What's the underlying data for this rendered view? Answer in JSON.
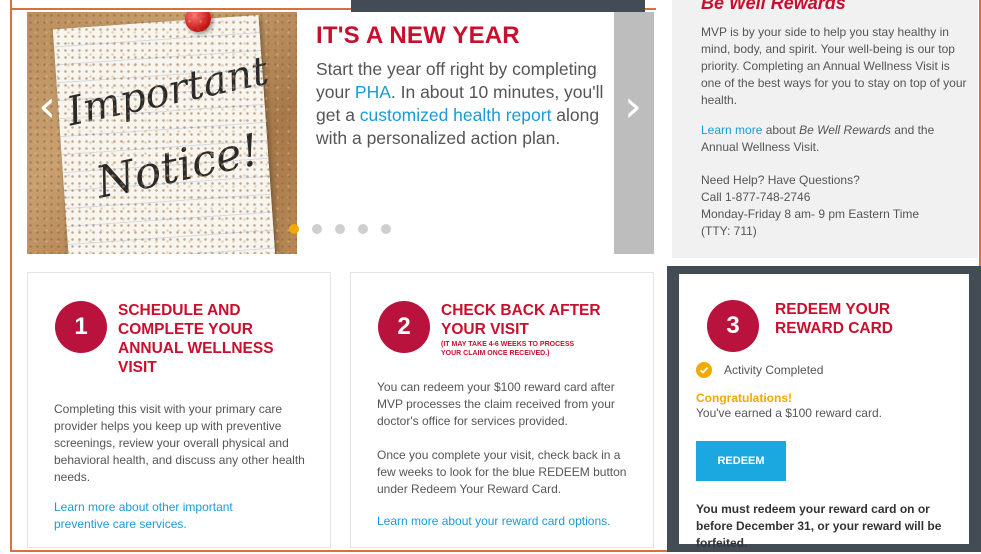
{
  "carousel": {
    "note_line1": "Important",
    "note_line2": "Notice!",
    "title": "IT'S A NEW YEAR",
    "body_pre": "Start the year off right by completing your ",
    "body_link1": "PHA",
    "body_mid": ". In about 10 minutes, you'll get a ",
    "body_link2": "customized health report",
    "body_post": " along with a personalized action plan.",
    "prev_arrow": "‹",
    "next_arrow": "›",
    "dot_count": 5,
    "active_dot": 0
  },
  "info": {
    "heading": "Be Well Rewards",
    "paragraph1": "MVP is by your side to help you stay healthy in mind, body, and spirit. Your well-being is our top priority. Completing an Annual Wellness Visit is one of the best ways for you to stay on top of your health.",
    "learn_more_link": "Learn more",
    "learn_more_mid": " about ",
    "learn_more_em": "Be Well Rewards",
    "learn_more_post": " and the Annual Wellness Visit.",
    "help_line1": "Need Help? Have Questions?",
    "help_line2": "Call 1-877-748-2746",
    "help_line3": "Monday-Friday 8 am- 9 pm Eastern Time",
    "help_line4": "(TTY: 711)"
  },
  "steps": [
    {
      "number": "1",
      "title_lines": [
        "SCHEDULE AND",
        "COMPLETE YOUR",
        "ANNUAL WELLNESS",
        "VISIT"
      ],
      "body": "Completing this visit with your primary care provider helps you keep up with preventive screenings, review your overall physical and behavioral health, and discuss any other health needs.",
      "link": "Learn more about other important preventive care services."
    },
    {
      "number": "2",
      "title_lines": [
        "CHECK BACK AFTER",
        "YOUR VISIT"
      ],
      "subtitle_lines": [
        "(IT MAY TAKE 4-6 WEEKS TO PROCESS",
        "YOUR CLAIM ONCE RECEIVED.)"
      ],
      "body1": "You can redeem your $100 reward card after MVP processes the claim received from your doctor's office for services provided.",
      "body2": "Once you complete your visit, check back in a few weeks to look for the blue REDEEM button under Redeem Your Reward Card.",
      "link": "Learn more about your reward card options."
    },
    {
      "number": "3",
      "title_lines": [
        "REDEEM YOUR",
        "REWARD CARD"
      ],
      "status": "Activity Completed",
      "congrats": "Congratulations!",
      "earned": "You've earned a $100 reward card.",
      "button": "REDEEM",
      "warning": "You must redeem your reward card on or before December 31, or your reward will be forfeited."
    }
  ],
  "colors": {
    "brand_red": "#c8102e",
    "badge": "#b8123d",
    "link": "#1b9ad6",
    "accent_gold": "#f2a900",
    "frame": "#d9713f",
    "dark": "#434c55"
  }
}
